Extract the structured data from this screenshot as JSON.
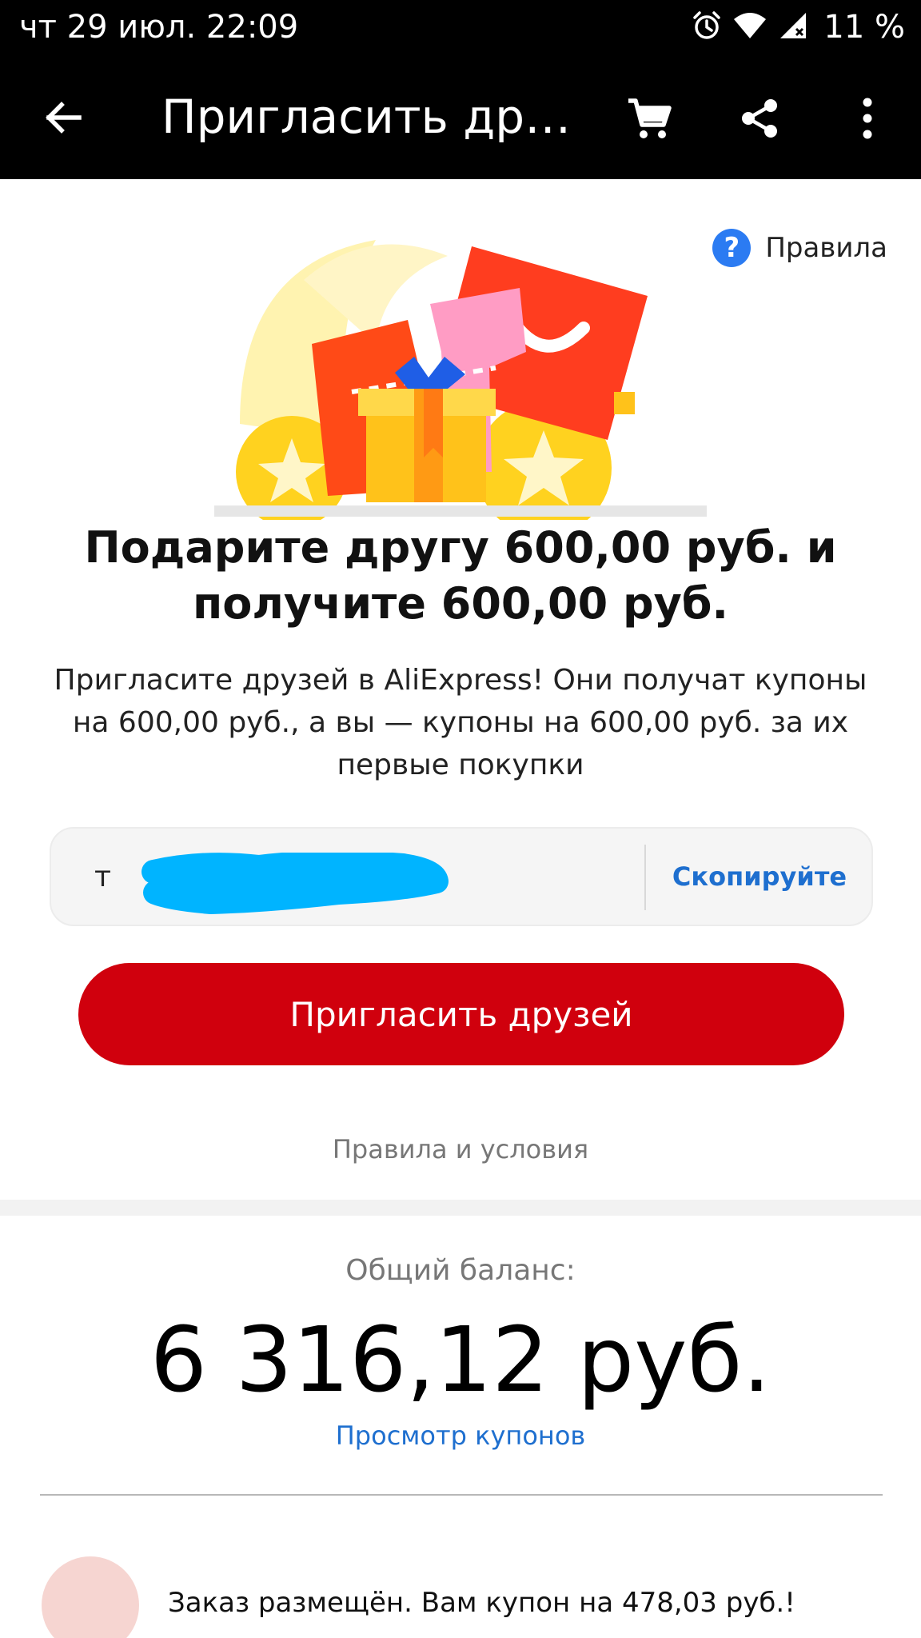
{
  "status_bar": {
    "time": "чт 29 июл. 22:09",
    "battery": "11 %",
    "icons": [
      "alarm-icon",
      "wifi-icon",
      "signal-icon"
    ]
  },
  "app_bar": {
    "title": "Пригласить дру...",
    "icons": [
      "back-arrow-icon",
      "cart-icon",
      "share-icon",
      "more-icon"
    ]
  },
  "rules_link": {
    "icon": "?",
    "label": "Правила"
  },
  "promo": {
    "headline": "Подарите другу 600,00 руб. и получите 600,00 руб.",
    "description": "Пригласите друзей в AliExpress! Они получат купоны на 600,00 руб., а вы — купоны на 600,00 руб. за их первые покупки"
  },
  "invite_code": {
    "value": "т",
    "copy_label": "Скопируйте"
  },
  "invite_button": {
    "label": "Пригласить друзей"
  },
  "terms_link": {
    "label": "Правила и условия"
  },
  "balance": {
    "label": "Общий баланс:",
    "amount": "6 316,12 руб.",
    "coupons_link": "Просмотр купонов"
  },
  "history": {
    "items": [
      {
        "text": "Заказ размещён. Вам купон на 478,03 руб.!"
      }
    ]
  },
  "colors": {
    "accent_red": "#d0000d",
    "link_blue": "#1e6fcf",
    "rules_blue": "#2b7bf2",
    "app_bar_bg": "#000000"
  }
}
